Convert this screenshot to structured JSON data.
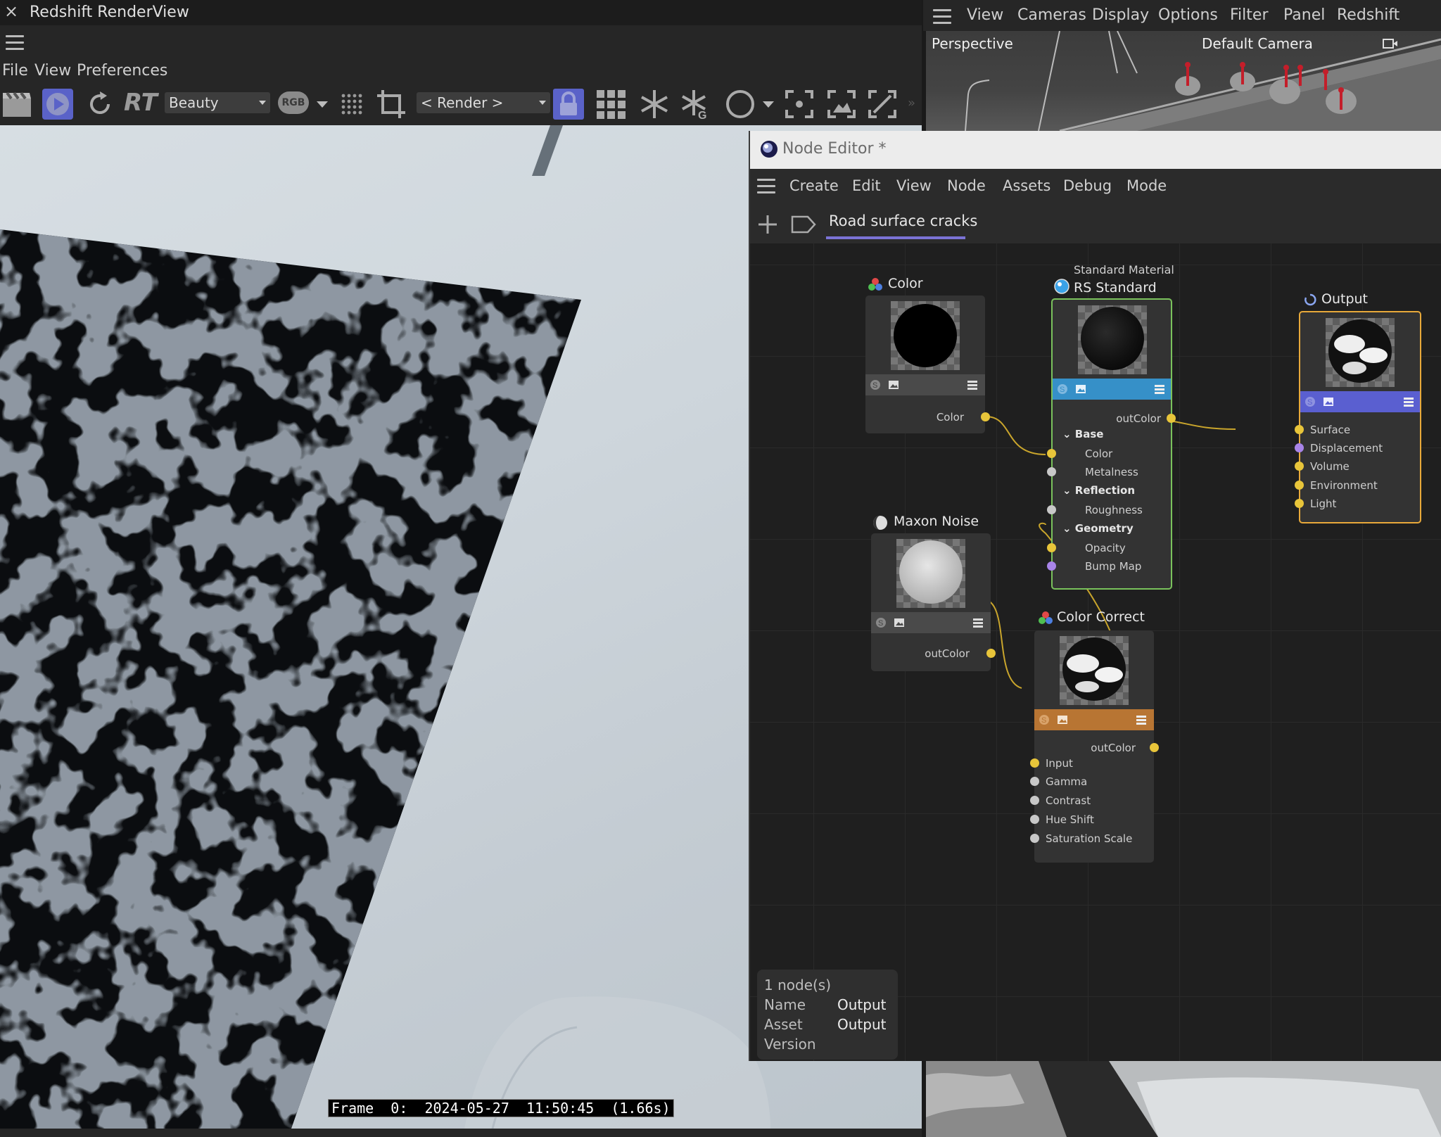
{
  "renderview": {
    "title": "Redshift RenderView",
    "close_glyph": "×",
    "menu": [
      "File",
      "View",
      "Preferences"
    ],
    "toolbar": {
      "rt_label": "RT",
      "aov_combo": "Beauty",
      "rgb_badge": "RGB",
      "render_combo": "< Render >"
    },
    "status": "Frame  0:  2024-05-27  11:50:45  (1.66s)"
  },
  "viewport": {
    "menu": [
      "View",
      "Cameras",
      "Display",
      "Options",
      "Filter",
      "Panel",
      "Redshift"
    ],
    "label_left": "Perspective",
    "label_camera": "Default Camera"
  },
  "node_editor": {
    "title": "Node Editor *",
    "menu": [
      "Create",
      "Edit",
      "View",
      "Node",
      "Assets",
      "Debug",
      "Mode"
    ],
    "tab": "Road surface cracks",
    "nodes": {
      "color": {
        "label": "Color",
        "outputs": [
          "Color"
        ],
        "bar_color": "#4a4a4a"
      },
      "rs_standard": {
        "subtitle": "Standard Material",
        "label": "RS Standard",
        "output": "outColor",
        "sections": [
          "Base",
          "Reflection",
          "Geometry"
        ],
        "inputs": [
          "Color",
          "Metalness",
          "Roughness",
          "Opacity",
          "Bump Map"
        ],
        "bar_color": "#3690c8",
        "border_color": "#7ac25c"
      },
      "output": {
        "label": "Output",
        "inputs": [
          "Surface",
          "Displacement",
          "Volume",
          "Environment",
          "Light"
        ],
        "bar_color": "#5a5fd0",
        "border_color": "#e8a93a"
      },
      "maxon_noise": {
        "label": "Maxon Noise",
        "output": "outColor",
        "bar_color": "#4a4a4a"
      },
      "color_correct": {
        "label": "Color Correct",
        "output": "outColor",
        "inputs": [
          "Input",
          "Gamma",
          "Contrast",
          "Hue Shift",
          "Saturation Scale"
        ],
        "bar_color": "#b87533"
      }
    },
    "info": {
      "count": "1 node(s)",
      "name_label": "Name",
      "name_value": "Output",
      "asset_label": "Asset",
      "asset_value": "Output",
      "version_label": "Version"
    }
  },
  "colors": {
    "port_yellow": "#e8c53a",
    "port_purple": "#a884e8",
    "wire": "#c9a52c",
    "tab_underline": "#7b73d6"
  }
}
